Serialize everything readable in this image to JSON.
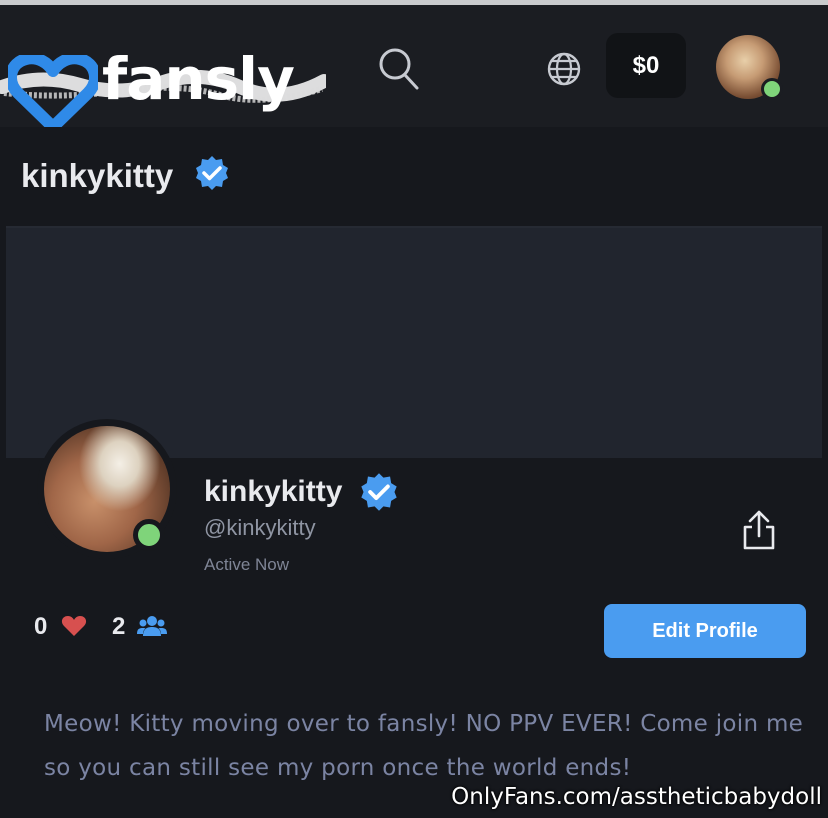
{
  "header": {
    "logo_text": "fansly",
    "wallet_balance": "$0",
    "brand_color": "#2f8ae8"
  },
  "subheader": {
    "title": "kinkykitty"
  },
  "profile": {
    "display_name": "kinkykitty",
    "handle": "@kinkykitty",
    "status": "Active Now",
    "likes_count": "0",
    "followers_count": "2",
    "edit_button_label": "Edit Profile",
    "bio": "Meow! Kitty moving over to fansly! NO PPV EVER! Come join me so you can still see my porn once the world ends!",
    "online_color": "#7fd47a",
    "verified_color": "#4a9cf0"
  },
  "watermark": "OnlyFans.com/asstheticbabydoll",
  "icons": {
    "search": "search-icon",
    "globe": "globe-icon",
    "share": "share-icon",
    "heart": "heart-icon",
    "followers": "people-icon",
    "verified": "verified-badge-icon"
  }
}
